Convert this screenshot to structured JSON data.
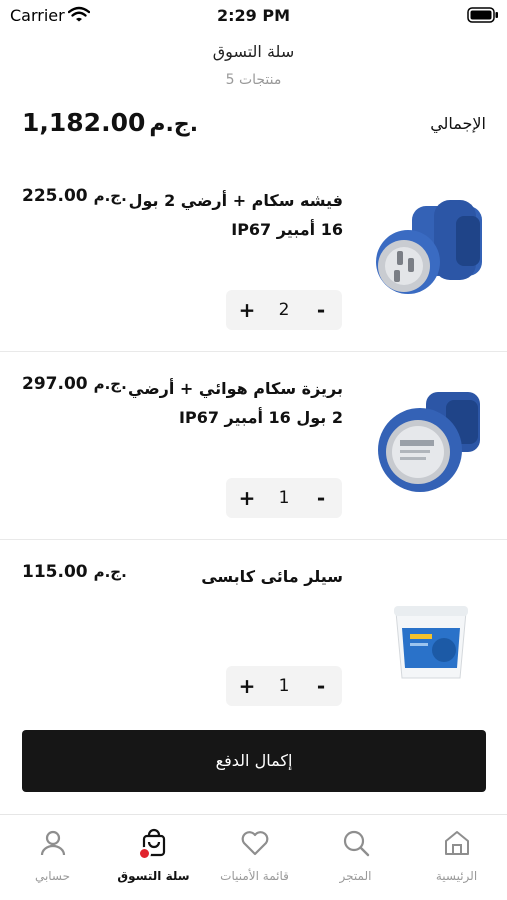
{
  "status_bar": {
    "carrier": "Carrier",
    "time": "2:29 PM"
  },
  "header": {
    "title": "سلة التسوق",
    "subtitle": "5 منتجات"
  },
  "total": {
    "label": "الإجمالي",
    "amount": "1,182.00",
    "currency": "ج.م."
  },
  "items": [
    {
      "name": "فيشه سكام + أرضي 2 بول 16 أمبير IP67",
      "price": "225.00",
      "currency": "ج.م.",
      "quantity": "2",
      "image_icon": "blue-plug-image"
    },
    {
      "name": "بريزة سكام هوائي + أرضي 2 بول 16 أمبير IP67",
      "price": "297.00",
      "currency": "ج.م.",
      "quantity": "1",
      "image_icon": "blue-socket-image"
    },
    {
      "name": "سيلر مائى كابسى",
      "price": "115.00",
      "currency": "ج.م.",
      "quantity": "1",
      "image_icon": "sealer-bucket-image"
    }
  ],
  "qty_controls": {
    "plus": "+",
    "minus": "-"
  },
  "checkout_label": "إكمال الدفع",
  "tabs": [
    {
      "label": "الرئيسية",
      "icon": "home-icon",
      "active": false
    },
    {
      "label": "المتجر",
      "icon": "search-icon",
      "active": false
    },
    {
      "label": "قائمة الأمنيات",
      "icon": "heart-icon",
      "active": false
    },
    {
      "label": "سلة التسوق",
      "icon": "cart-bag-icon",
      "active": true
    },
    {
      "label": "حسابي",
      "icon": "profile-icon",
      "active": false
    }
  ],
  "colors": {
    "accent_dot": "#e1242e",
    "checkout_bg": "#161616",
    "plug_blue": "#2f5fb8"
  }
}
